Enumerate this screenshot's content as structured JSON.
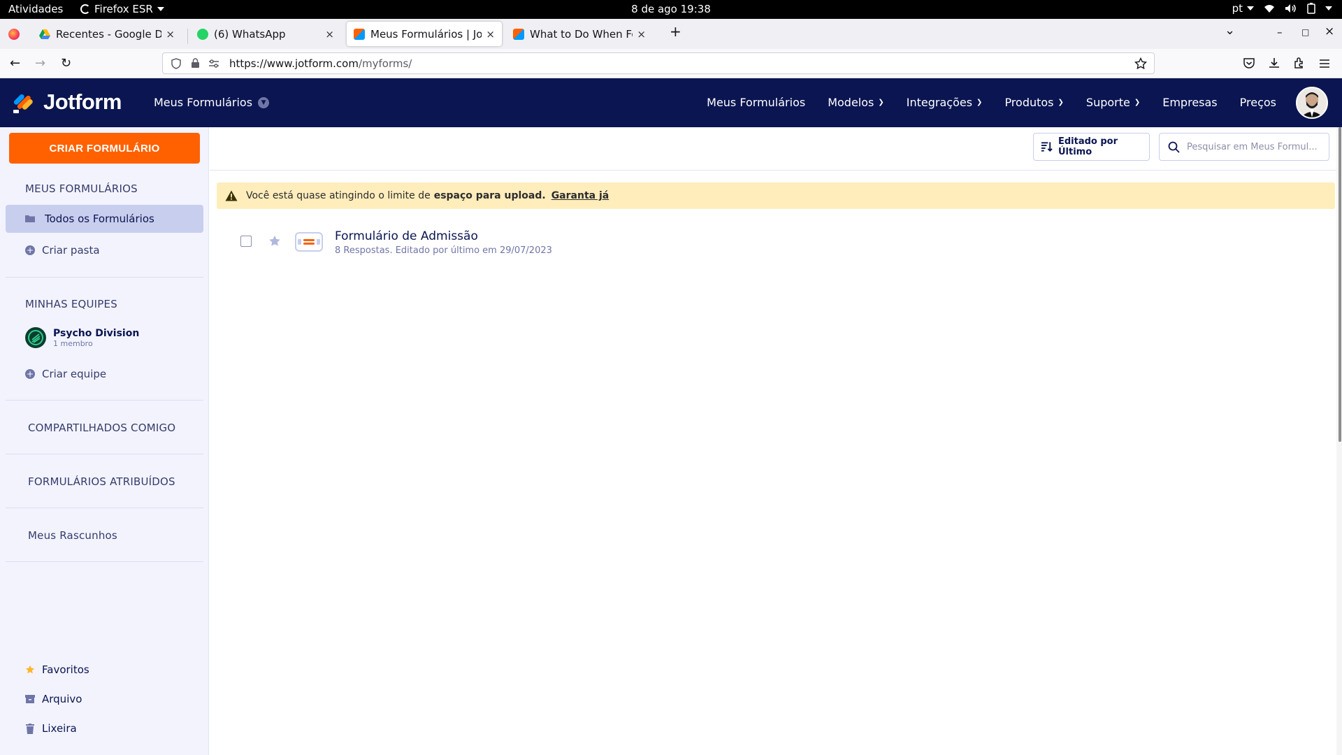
{
  "system": {
    "activities": "Atividades",
    "app_name": "Firefox ESR",
    "clock": "8 de ago  19:38",
    "lang": "pt"
  },
  "tabs": [
    {
      "title": "Recentes - Google Drive",
      "close": "×"
    },
    {
      "title": "(6) WhatsApp",
      "close": "×"
    },
    {
      "title": "Meus Formulários | Jotfor",
      "close": "×"
    },
    {
      "title": "What to Do When Form S",
      "close": "×"
    }
  ],
  "tabstrip": {
    "new_tab": "+",
    "list_all": "⌄",
    "minimize": "–",
    "maximize": "□",
    "close": "×"
  },
  "navbar": {
    "back": "←",
    "forward": "→",
    "reload": "↻",
    "url_host": "https://www.jotform.com",
    "url_path": "/myforms/"
  },
  "header": {
    "brand": "Jotform",
    "breadcrumb": "Meus Formulários",
    "nav": [
      {
        "label": "Meus Formulários",
        "dropdown": false
      },
      {
        "label": "Modelos",
        "dropdown": true
      },
      {
        "label": "Integrações",
        "dropdown": true
      },
      {
        "label": "Produtos",
        "dropdown": true
      },
      {
        "label": "Suporte",
        "dropdown": true
      },
      {
        "label": "Empresas",
        "dropdown": false
      },
      {
        "label": "Preços",
        "dropdown": false
      }
    ]
  },
  "sidebar": {
    "create_label": "CRIAR FORMULÁRIO",
    "my_forms_heading": "MEUS FORMULÁRIOS",
    "all_forms": "Todos os Formulários",
    "create_folder": "Criar pasta",
    "teams_heading": "MINHAS EQUIPES",
    "team": {
      "name": "Psycho Division",
      "members": "1 membro"
    },
    "create_team": "Criar equipe",
    "shared": "COMPARTILHADOS COMIGO",
    "assigned": "FORMULÁRIOS ATRIBUÍDOS",
    "drafts": "Meus Rascunhos",
    "favorites": "Favoritos",
    "archive": "Arquivo",
    "trash": "Lixeira"
  },
  "toolbar": {
    "sort_label": "Editado por Último",
    "search_placeholder": "Pesquisar em Meus Formul..."
  },
  "warning": {
    "text": "Você está quase atingindo o limite de",
    "bold": "espaço para upload.",
    "link": "Garanta já"
  },
  "forms": [
    {
      "title": "Formulário de Admissão",
      "meta": "8 Respostas. Editado por último em 29/07/2023"
    }
  ],
  "colors": {
    "header_bg": "#0a1551",
    "accent_orange": "#ff6100",
    "sidebar_bg": "#f3f3fe",
    "warning_bg": "#ffedbc"
  }
}
